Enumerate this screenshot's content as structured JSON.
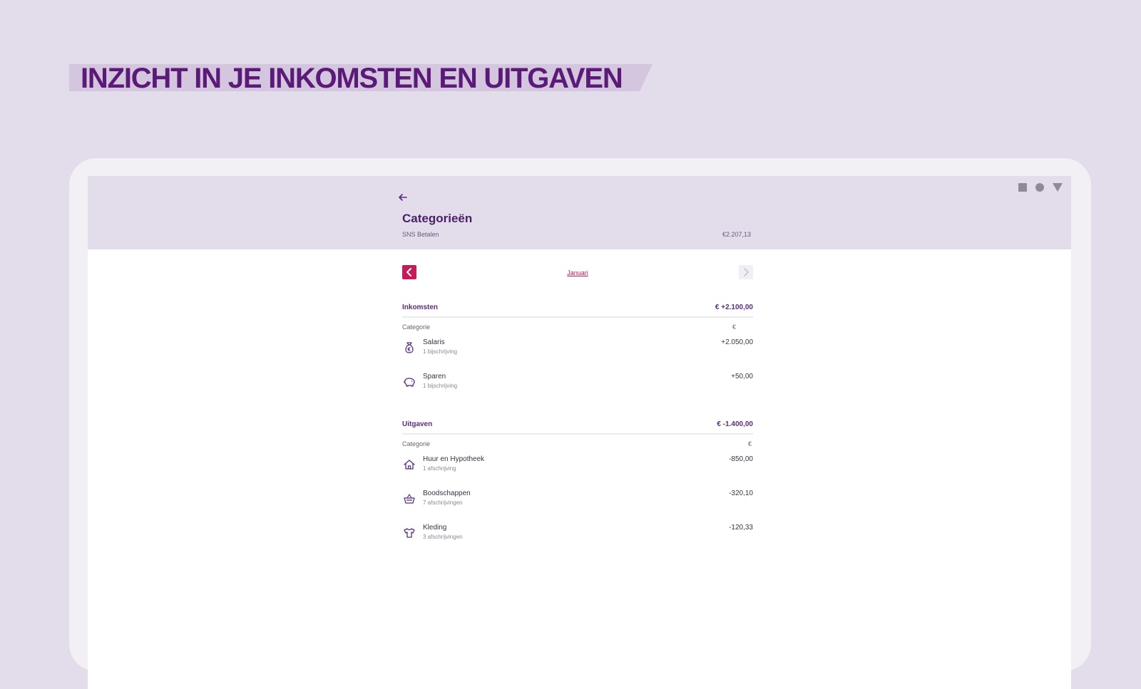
{
  "headline": "INZICHT IN JE INKOMSTEN EN UITGAVEN",
  "app": {
    "title": "Categorieën",
    "account": "SNS Betalen",
    "balance": "€2.207,13",
    "month": "Januari",
    "income": {
      "title": "Inkomsten",
      "total": "€ +2.100,00",
      "col_category": "Categorie",
      "col_currency": "€",
      "items": [
        {
          "name": "Salaris",
          "sub": "1 bijschrijving",
          "amount": "+2.050,00",
          "icon": "money-bag-icon"
        },
        {
          "name": "Sparen",
          "sub": "1 bijschrijving",
          "amount": "+50,00",
          "icon": "piggy-bank-icon"
        }
      ]
    },
    "expenses": {
      "title": "Uitgaven",
      "total": "€ -1.400,00",
      "col_category": "Categorie",
      "col_currency": "€",
      "items": [
        {
          "name": "Huur en Hypotheek",
          "sub": "1 afschrijving",
          "amount": "-850,00",
          "icon": "house-icon"
        },
        {
          "name": "Boodschappen",
          "sub": "7 afschrijvingen",
          "amount": "-320,10",
          "icon": "shopping-basket-icon"
        },
        {
          "name": "Kleding",
          "sub": "3 afschrijvingen",
          "amount": "-120,33",
          "icon": "shirt-icon"
        }
      ]
    }
  },
  "colors": {
    "background": "#e3dcea",
    "headline": "#5b1a78",
    "accent": "#c51a5b",
    "section_text": "#5b2c7a"
  }
}
